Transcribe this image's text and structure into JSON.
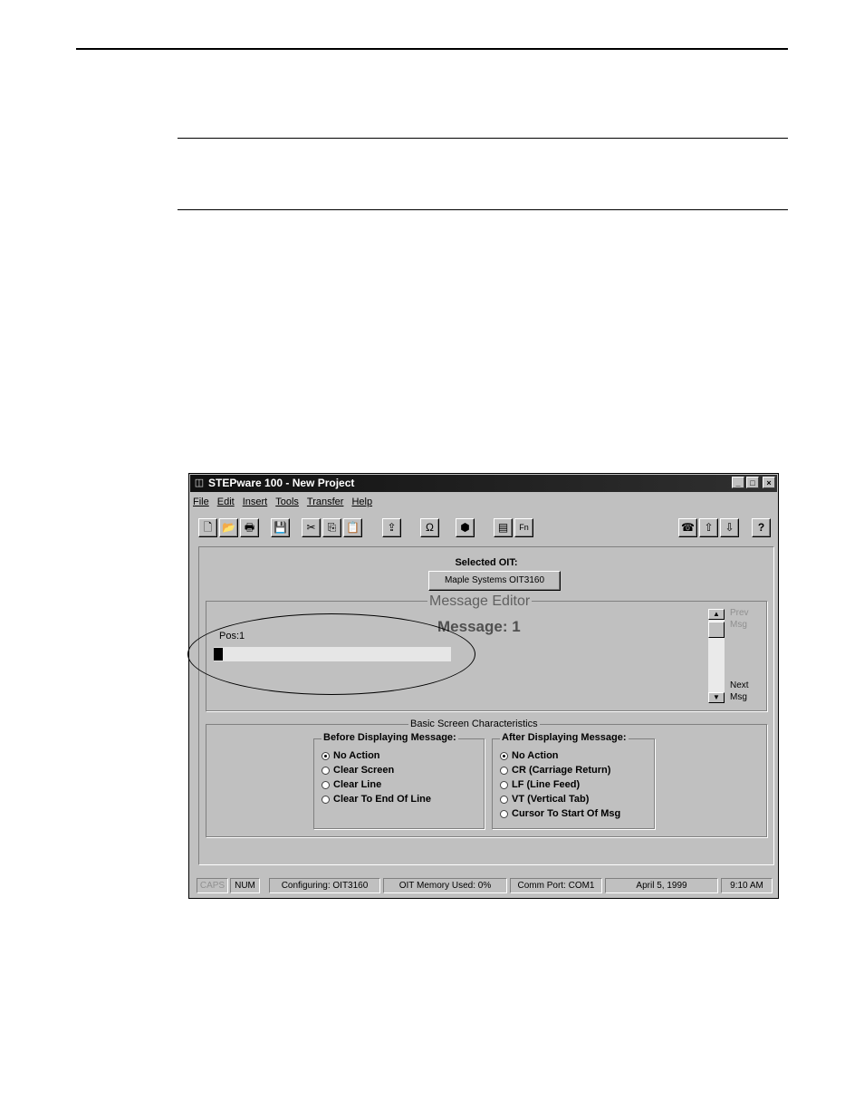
{
  "window": {
    "title": "STEPware 100 - New Project",
    "controls": [
      "_",
      "□",
      "×"
    ]
  },
  "menu": [
    "File",
    "Edit",
    "Insert",
    "Tools",
    "Transfer",
    "Help"
  ],
  "toolbar": {
    "icons": [
      "new-file-icon",
      "open-file-icon",
      "print-icon",
      "save-icon",
      "cut-icon",
      "copy-icon",
      "paste-icon",
      "upload-icon",
      "omega-symbol-icon",
      "download-icon",
      "print-setup-icon",
      "function-key-icon",
      "dial-icon",
      "send-icon",
      "receive-icon",
      "help-icon"
    ],
    "glyphs": {
      "new": "🗋",
      "open": "📂",
      "print": "🖶",
      "save": "💾",
      "cut": "✂",
      "copy": "⎘",
      "paste": "📋",
      "upload": "⇪",
      "omega": "Ω",
      "download": "⬢",
      "printsetup": "▤",
      "fkey": "Fn",
      "dial": "☎",
      "send": "⇧",
      "receive": "⇩",
      "help": "?"
    }
  },
  "selected_oit": {
    "label": "Selected OIT:",
    "button": "Maple Systems OIT3160"
  },
  "message_editor": {
    "title": "Message Editor",
    "message_label": "Message: 1",
    "pos_label": "Pos:1",
    "prev_label": "Prev Msg",
    "next_label": "Next Msg"
  },
  "basic_screen": {
    "title": "Basic Screen Characteristics",
    "before": {
      "title": "Before Displaying Message:",
      "options": [
        "No Action",
        "Clear Screen",
        "Clear Line",
        "Clear To End Of Line"
      ],
      "selected": 0
    },
    "after": {
      "title": "After Displaying Message:",
      "options": [
        "No Action",
        "CR (Carriage Return)",
        "LF (Line Feed)",
        "VT (Vertical Tab)",
        "Cursor To Start Of Msg"
      ],
      "selected": 0
    }
  },
  "status_bar": {
    "caps": "CAPS",
    "num": "NUM",
    "configuring": "Configuring: OIT3160",
    "memory": "OIT Memory Used: 0%",
    "comm_port": "Comm Port: COM1",
    "date": "April 5, 1999",
    "time": "9:10 AM"
  },
  "colors": {
    "window_bg": "#c0c0c0",
    "title_bar": "#101010",
    "disabled_text": "#909090"
  }
}
